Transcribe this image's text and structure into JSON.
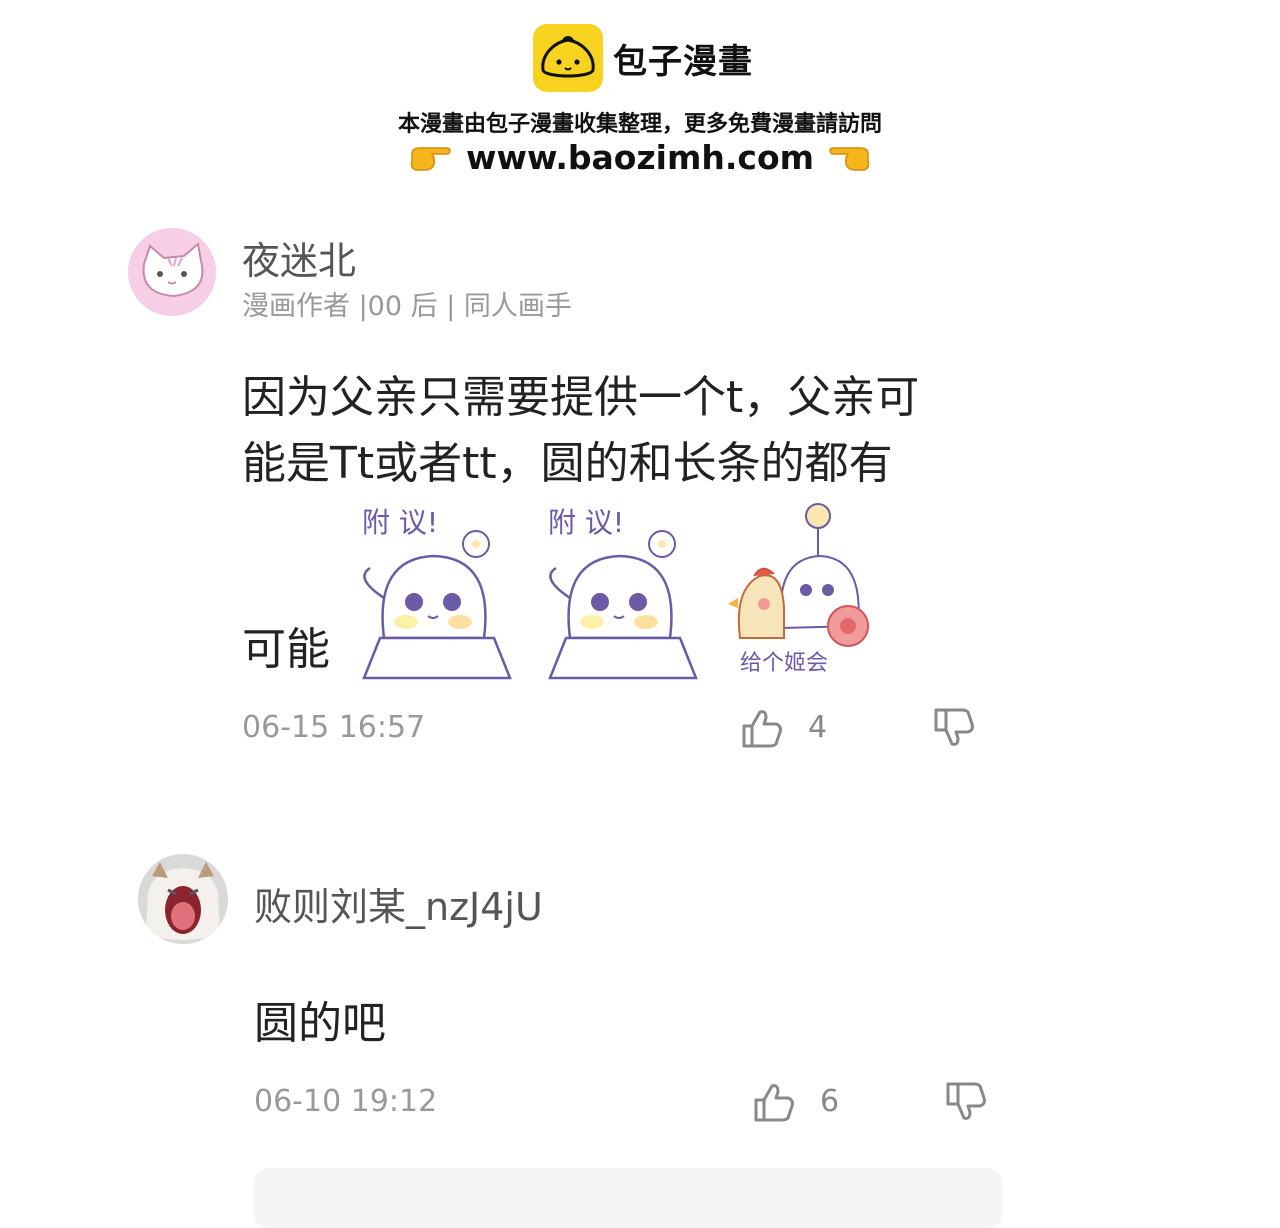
{
  "header": {
    "brand_name": "包子漫畫",
    "notice": "本漫畫由包子漫畫收集整理，更多免費漫畫請訪問",
    "url": "www.baozimh.com"
  },
  "comments": [
    {
      "username": "夜迷北",
      "tags": "漫画作者 |00 后 | 同人画手",
      "text_line1": "因为父亲只需要提供一个t，父亲可",
      "text_line2": "能是Tt或者tt，圆的和长条的都有",
      "text_line3": "可能",
      "stickers": [
        {
          "caption": "附 议!"
        },
        {
          "caption": "附 议!"
        },
        {
          "caption": "给个姬会"
        }
      ],
      "time": "06-15 16:57",
      "likes": "4"
    },
    {
      "username": "败则刘某_nzJ4jU",
      "text": "圆的吧",
      "time": "06-10 19:12",
      "likes": "6"
    }
  ],
  "colors": {
    "brand_yellow": "#f7d21e",
    "meta_gray": "#999999",
    "name_gray": "#555555"
  },
  "icons": [
    "bun-logo-icon",
    "pointing-right-hand-icon",
    "pointing-left-hand-icon",
    "thumbs-up-icon",
    "thumbs-down-icon"
  ]
}
